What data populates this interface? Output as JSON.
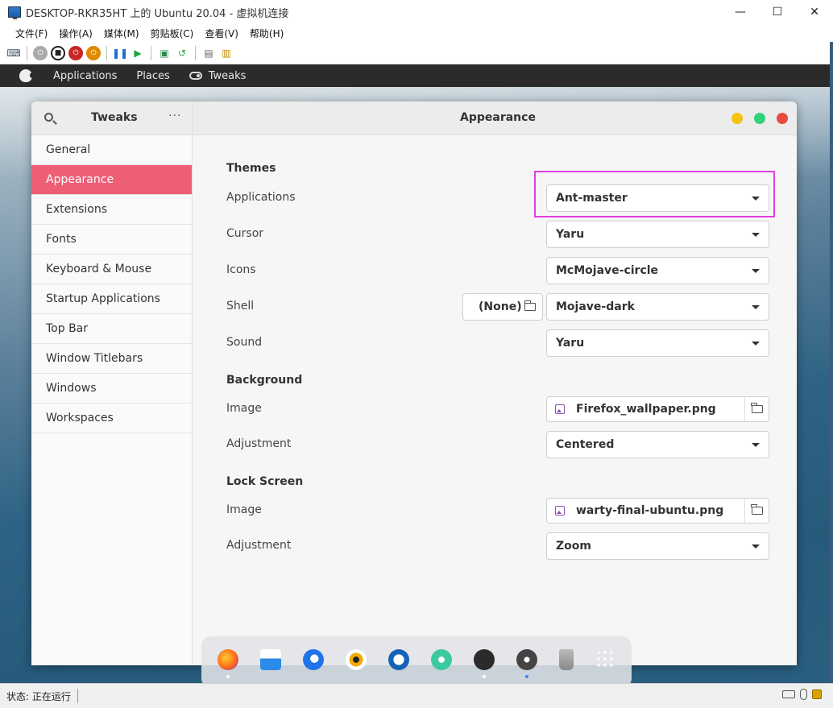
{
  "host": {
    "title": "DESKTOP-RKR35HT 上的 Ubuntu 20.04 - 虚拟机连接",
    "controls": {
      "minimize": "—",
      "maximize": "☐",
      "close": "✕"
    },
    "menu": [
      "文件(F)",
      "操作(A)",
      "媒体(M)",
      "剪贴板(C)",
      "查看(V)",
      "帮助(H)"
    ],
    "status_text": "状态: 正在运行"
  },
  "topbar": {
    "applications": "Applications",
    "places": "Places",
    "tweaks": "Tweaks"
  },
  "tweaks": {
    "app_title": "Tweaks",
    "more": "···",
    "page_title": "Appearance",
    "window_dots": {
      "minimize": "#f5c211",
      "maximize": "#33d17a",
      "close": "#e74c3c"
    },
    "sidebar": [
      {
        "label": "General"
      },
      {
        "label": "Appearance"
      },
      {
        "label": "Extensions"
      },
      {
        "label": "Fonts"
      },
      {
        "label": "Keyboard & Mouse"
      },
      {
        "label": "Startup Applications"
      },
      {
        "label": "Top Bar"
      },
      {
        "label": "Window Titlebars"
      },
      {
        "label": "Windows"
      },
      {
        "label": "Workspaces"
      }
    ],
    "active_item": "Appearance",
    "accent_color": "#ee5e74",
    "themes": {
      "title": "Themes",
      "applications": {
        "label": "Applications",
        "value": "Ant-master"
      },
      "cursor": {
        "label": "Cursor",
        "value": "Yaru"
      },
      "icons": {
        "label": "Icons",
        "value": "McMojave-circle"
      },
      "shell": {
        "label": "Shell",
        "value": "Mojave-dark",
        "file_value": "(None)"
      },
      "sound": {
        "label": "Sound",
        "value": "Yaru"
      }
    },
    "background": {
      "title": "Background",
      "image": {
        "label": "Image",
        "value": "Firefox_wallpaper.png"
      },
      "adjustment": {
        "label": "Adjustment",
        "value": "Centered"
      }
    },
    "lock_screen": {
      "title": "Lock Screen",
      "image": {
        "label": "Image",
        "value": "warty-final-ubuntu.png"
      },
      "adjustment": {
        "label": "Adjustment",
        "value": "Zoom"
      }
    },
    "highlight_color": "#e03ee0"
  },
  "dock": [
    {
      "name": "firefox-icon",
      "running": true
    },
    {
      "name": "mail-icon",
      "running": false
    },
    {
      "name": "browser-icon",
      "running": false
    },
    {
      "name": "media-player-icon",
      "running": false
    },
    {
      "name": "document-viewer-icon",
      "running": false
    },
    {
      "name": "network-icon",
      "running": false
    },
    {
      "name": "terminal-icon",
      "running": true
    },
    {
      "name": "tweaks-icon",
      "running": true
    },
    {
      "name": "trash-icon",
      "running": false
    },
    {
      "name": "app-grid-icon",
      "running": false
    }
  ]
}
